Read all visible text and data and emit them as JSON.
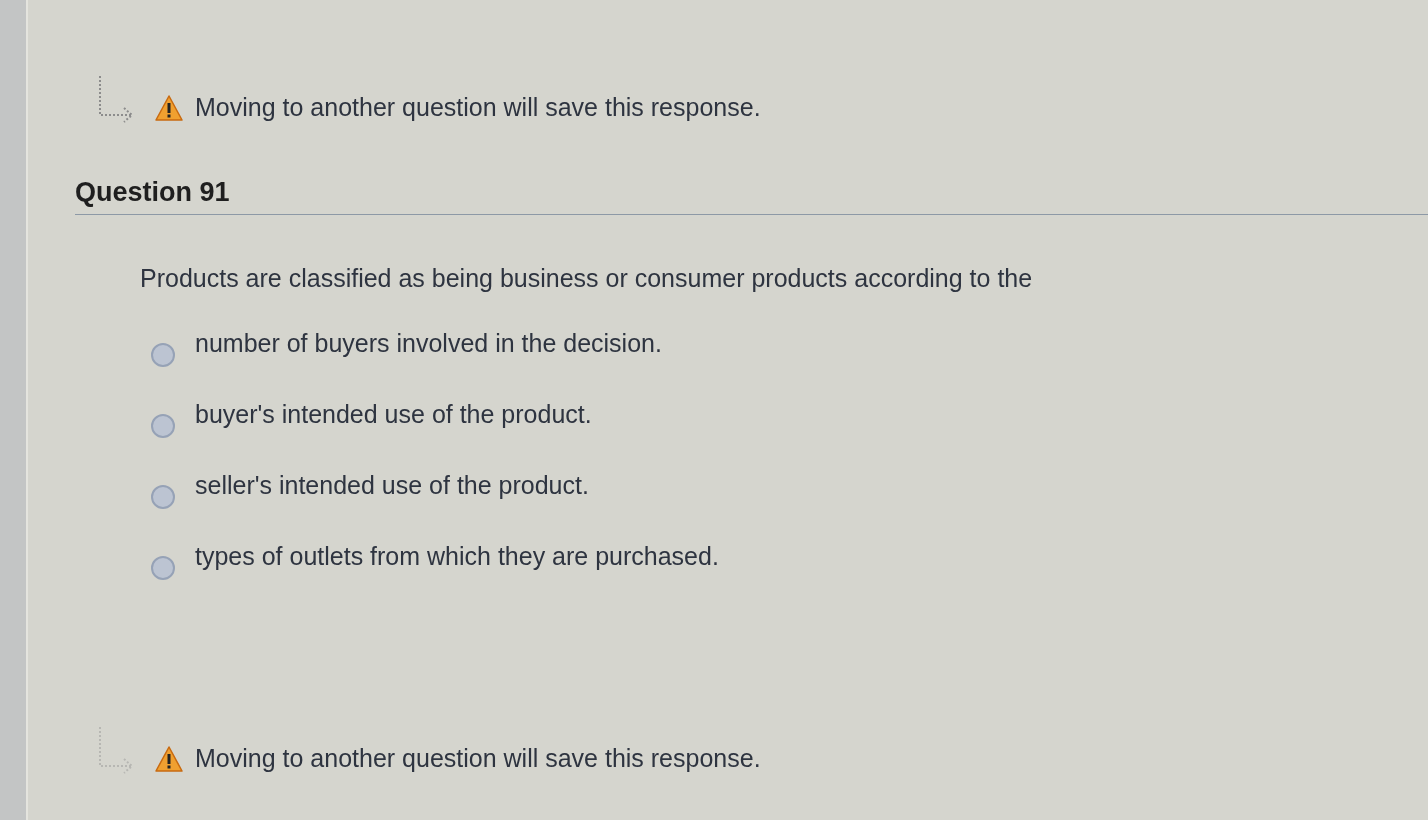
{
  "notice_top": {
    "text": "Moving to another question will save this response."
  },
  "question": {
    "title": "Question 91",
    "prompt": "Products are classified as being business or consumer products according to the",
    "options": [
      {
        "label": "number of buyers involved in the decision.",
        "selected": false
      },
      {
        "label": "buyer's intended use of the product.",
        "selected": false
      },
      {
        "label": "seller's intended use of the product.",
        "selected": false
      },
      {
        "label": "types of outlets from which they are purchased.",
        "selected": false
      }
    ]
  },
  "notice_bottom": {
    "text": "Moving to another question will save this response."
  }
}
